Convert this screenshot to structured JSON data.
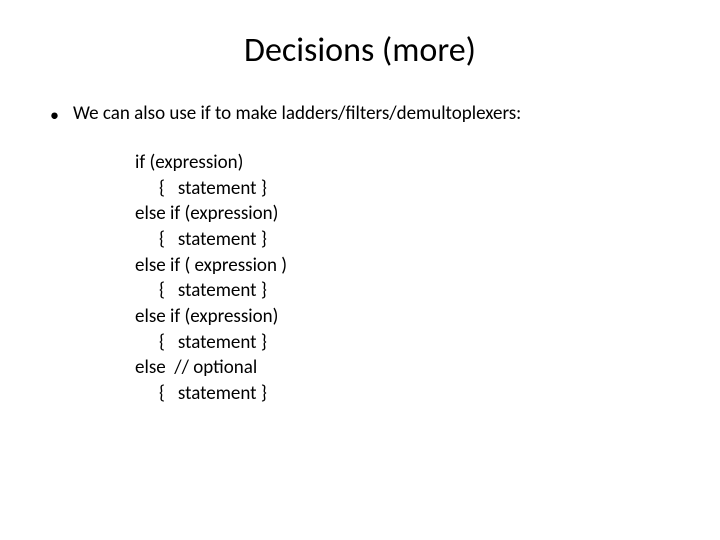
{
  "title": "Decisions (more)",
  "bullet": {
    "dot": "•",
    "text": "We can also use if to make ladders/filters/demultoplexers:"
  },
  "code": {
    "l1": "if (expression)",
    "l2": "{   statement }",
    "l3": "else if (expression)",
    "l4": "{   statement }",
    "l5": "else if ( expression )",
    "l6": "{   statement }",
    "l7": "else if (expression)",
    "l8": "{   statement }",
    "l9": "else  // optional",
    "l10": "{   statement }"
  }
}
